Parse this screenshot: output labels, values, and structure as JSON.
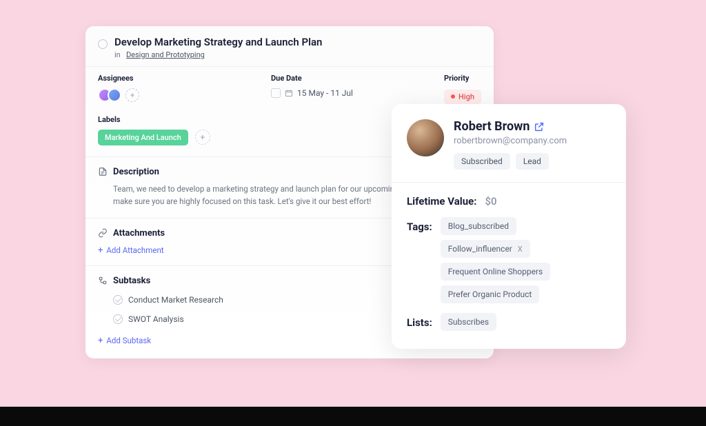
{
  "task": {
    "title": "Develop Marketing Strategy and Launch Plan",
    "breadcrumb_prefix": "in",
    "breadcrumb_link": "Design and Prototyping",
    "assignees_label": "Assignees",
    "duedate_label": "Due Date",
    "duedate_value": "15 May - 11 Jul",
    "priority_label": "Priority",
    "priority_value": "High",
    "labels_label": "Labels",
    "label_chip": "Marketing And Launch",
    "description_label": "Description",
    "description_text": "Team, we need to develop a marketing strategy and launch plan for our upcoming new product. Please make sure you are highly focused on this task. Let's give it our best effort!",
    "attachments_label": "Attachments",
    "add_attachment": "Add Attachment",
    "subtasks_label": "Subtasks",
    "subtasks": [
      {
        "title": "Conduct Market Research"
      },
      {
        "title": "SWOT Analysis"
      }
    ],
    "add_subtask": "Add Subtask"
  },
  "contact": {
    "name": "Robert Brown",
    "email": "robertbrown@company.com",
    "status_chips": [
      "Subscribed",
      "Lead"
    ],
    "ltv_label": "Lifetime Value:",
    "ltv_value": "$0",
    "tags_label": "Tags:",
    "tags": [
      {
        "text": "Blog_subscribed",
        "removable": false
      },
      {
        "text": "Follow_influencer",
        "removable": true
      },
      {
        "text": "Frequent Online Shoppers",
        "removable": false
      },
      {
        "text": "Prefer Organic Product",
        "removable": false
      }
    ],
    "lists_label": "Lists:",
    "lists": [
      "Subscribes"
    ]
  }
}
